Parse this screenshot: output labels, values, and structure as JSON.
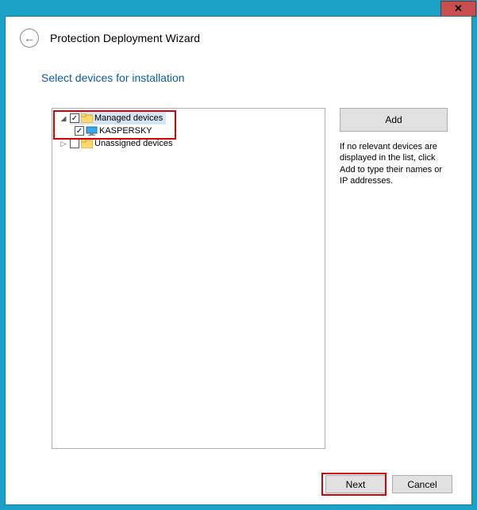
{
  "titlebar": {
    "close_glyph": "✕"
  },
  "header": {
    "back_glyph": "←",
    "title": "Protection Deployment Wizard"
  },
  "subtitle": "Select devices for installation",
  "tree": {
    "node1": {
      "expander": "◢",
      "label": "Managed devices"
    },
    "node2": {
      "label": "KASPERSKY"
    },
    "node3": {
      "expander": "▷",
      "label": "Unassigned devices"
    }
  },
  "right": {
    "add_label": "Add",
    "help_text": "If no relevant devices are displayed in the list, click Add to type their names or IP addresses."
  },
  "footer": {
    "next": "Next",
    "cancel": "Cancel"
  }
}
